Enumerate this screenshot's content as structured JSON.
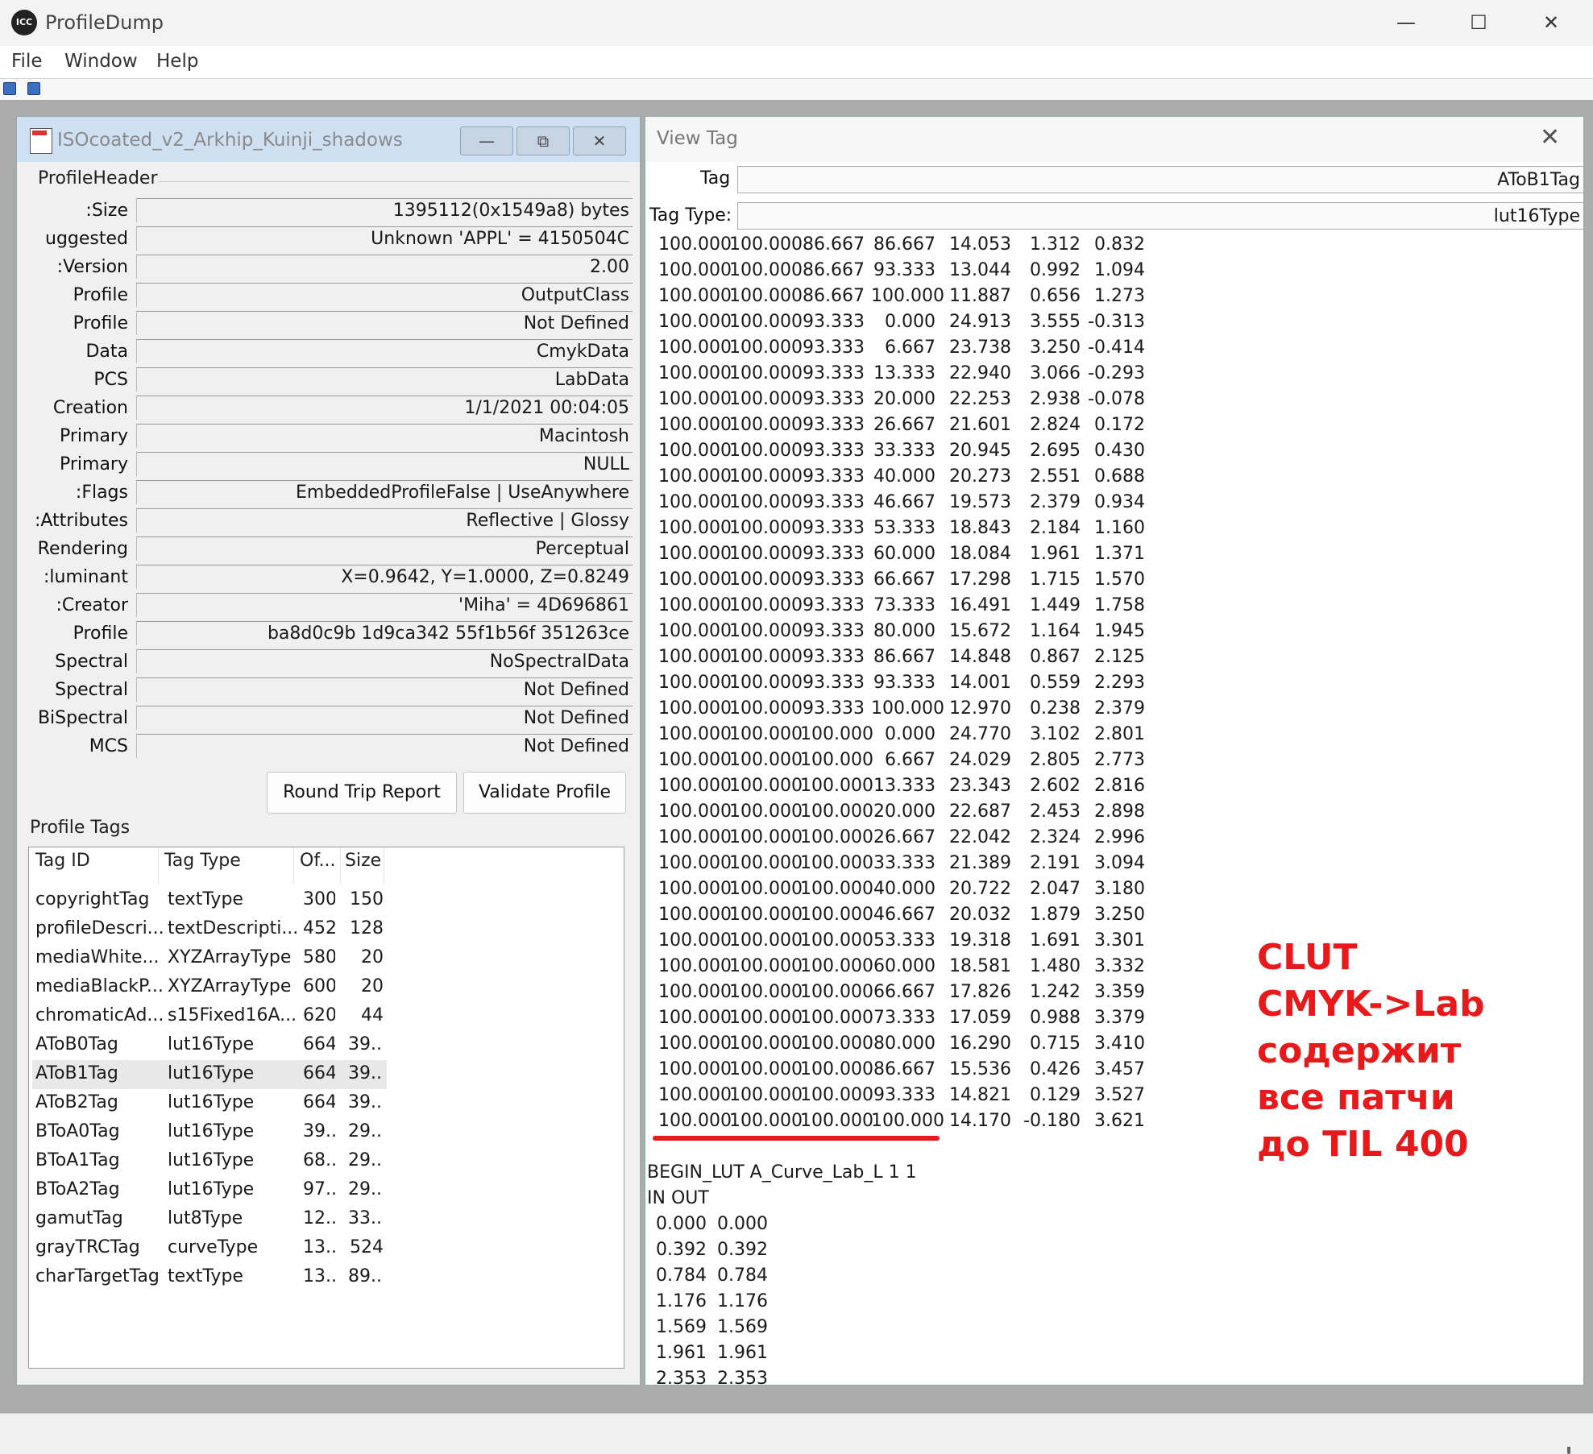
{
  "app": {
    "title": "ProfileDump",
    "icon_name": "icc-logo-icon"
  },
  "menu": [
    "File",
    "Window",
    "Help"
  ],
  "profile_window": {
    "title": "ISOcoated_v2_Arkhip_Kuinji_shadows",
    "section_header": "ProfileHeader",
    "header_fields": [
      {
        "label": "Size:",
        "value": "1395112(0x1549a8) bytes"
      },
      {
        "label": "uggested",
        "value": "Unknown 'APPL' = 4150504C"
      },
      {
        "label": "Version:",
        "value": "2.00"
      },
      {
        "label": "Profile",
        "value": "OutputClass"
      },
      {
        "label": "Profile",
        "value": "Not Defined"
      },
      {
        "label": "Data",
        "value": "CmykData"
      },
      {
        "label": "PCS",
        "value": "LabData"
      },
      {
        "label": "Creation",
        "value": "1/1/2021  00:04:05"
      },
      {
        "label": "Primary",
        "value": "Macintosh"
      },
      {
        "label": "Primary",
        "value": "NULL"
      },
      {
        "label": "Flags:",
        "value": "EmbeddedProfileFalse | UseAnywhere"
      },
      {
        "label": "Attributes:",
        "value": "Reflective | Glossy"
      },
      {
        "label": "Rendering",
        "value": "Perceptual"
      },
      {
        "label": "luminant:",
        "value": "X=0.9642, Y=1.0000, Z=0.8249"
      },
      {
        "label": "Creator:",
        "value": "'Miha' = 4D696861"
      },
      {
        "label": "Profile",
        "value": "ba8d0c9b 1d9ca342 55f1b56f 351263ce"
      },
      {
        "label": "Spectral",
        "value": "NoSpectralData"
      },
      {
        "label": "Spectral",
        "value": "Not Defined"
      },
      {
        "label": "BiSpectral",
        "value": "Not Defined"
      },
      {
        "label": "MCS",
        "value": "Not Defined"
      }
    ],
    "buttons": {
      "round_trip": "Round Trip Report",
      "validate": "Validate Profile"
    },
    "tags_label": "Profile Tags",
    "tags_columns": [
      "Tag ID",
      "Tag Type",
      "Of...",
      "Size"
    ],
    "tags": [
      [
        "copyrightTag",
        "textType",
        "300",
        "150"
      ],
      [
        "profileDescri...",
        "textDescripti...",
        "452",
        "128"
      ],
      [
        "mediaWhite...",
        "XYZArrayType",
        "580",
        "20"
      ],
      [
        "mediaBlackP...",
        "XYZArrayType",
        "600",
        "20"
      ],
      [
        "chromaticAd...",
        "s15Fixed16A...",
        "620",
        "44"
      ],
      [
        "AToB0Tag",
        "lut16Type",
        "664",
        "39..."
      ],
      [
        "AToB1Tag",
        "lut16Type",
        "664",
        "39..."
      ],
      [
        "AToB2Tag",
        "lut16Type",
        "664",
        "39..."
      ],
      [
        "BToA0Tag",
        "lut16Type",
        "39...",
        "29..."
      ],
      [
        "BToA1Tag",
        "lut16Type",
        "68...",
        "29..."
      ],
      [
        "BToA2Tag",
        "lut16Type",
        "97...",
        "29..."
      ],
      [
        "gamutTag",
        "lut8Type",
        "12...",
        "33..."
      ],
      [
        "grayTRCTag",
        "curveType",
        "13...",
        "524"
      ],
      [
        "charTargetTag",
        "textType",
        "13...",
        "89..."
      ]
    ],
    "selected_tag": "AToB1Tag"
  },
  "view_tag": {
    "title": "View Tag",
    "tag_label": "Tag",
    "tag_value": "AToB1Tag",
    "type_label": "Tag Type:",
    "type_value": "lut16Type",
    "clut_rows": [
      [
        "100.000",
        "100.000",
        "86.667",
        "86.667",
        "14.053",
        "1.312",
        "0.832"
      ],
      [
        "100.000",
        "100.000",
        "86.667",
        "93.333",
        "13.044",
        "0.992",
        "1.094"
      ],
      [
        "100.000",
        "100.000",
        "86.667",
        "100.000",
        "11.887",
        "0.656",
        "1.273"
      ],
      [
        "100.000",
        "100.000",
        "93.333",
        "0.000",
        "24.913",
        "3.555",
        "-0.313"
      ],
      [
        "100.000",
        "100.000",
        "93.333",
        "6.667",
        "23.738",
        "3.250",
        "-0.414"
      ],
      [
        "100.000",
        "100.000",
        "93.333",
        "13.333",
        "22.940",
        "3.066",
        "-0.293"
      ],
      [
        "100.000",
        "100.000",
        "93.333",
        "20.000",
        "22.253",
        "2.938",
        "-0.078"
      ],
      [
        "100.000",
        "100.000",
        "93.333",
        "26.667",
        "21.601",
        "2.824",
        "0.172"
      ],
      [
        "100.000",
        "100.000",
        "93.333",
        "33.333",
        "20.945",
        "2.695",
        "0.430"
      ],
      [
        "100.000",
        "100.000",
        "93.333",
        "40.000",
        "20.273",
        "2.551",
        "0.688"
      ],
      [
        "100.000",
        "100.000",
        "93.333",
        "46.667",
        "19.573",
        "2.379",
        "0.934"
      ],
      [
        "100.000",
        "100.000",
        "93.333",
        "53.333",
        "18.843",
        "2.184",
        "1.160"
      ],
      [
        "100.000",
        "100.000",
        "93.333",
        "60.000",
        "18.084",
        "1.961",
        "1.371"
      ],
      [
        "100.000",
        "100.000",
        "93.333",
        "66.667",
        "17.298",
        "1.715",
        "1.570"
      ],
      [
        "100.000",
        "100.000",
        "93.333",
        "73.333",
        "16.491",
        "1.449",
        "1.758"
      ],
      [
        "100.000",
        "100.000",
        "93.333",
        "80.000",
        "15.672",
        "1.164",
        "1.945"
      ],
      [
        "100.000",
        "100.000",
        "93.333",
        "86.667",
        "14.848",
        "0.867",
        "2.125"
      ],
      [
        "100.000",
        "100.000",
        "93.333",
        "93.333",
        "14.001",
        "0.559",
        "2.293"
      ],
      [
        "100.000",
        "100.000",
        "93.333",
        "100.000",
        "12.970",
        "0.238",
        "2.379"
      ],
      [
        "100.000",
        "100.000",
        "100.000",
        "0.000",
        "24.770",
        "3.102",
        "2.801"
      ],
      [
        "100.000",
        "100.000",
        "100.000",
        "6.667",
        "24.029",
        "2.805",
        "2.773"
      ],
      [
        "100.000",
        "100.000",
        "100.000",
        "13.333",
        "23.343",
        "2.602",
        "2.816"
      ],
      [
        "100.000",
        "100.000",
        "100.000",
        "20.000",
        "22.687",
        "2.453",
        "2.898"
      ],
      [
        "100.000",
        "100.000",
        "100.000",
        "26.667",
        "22.042",
        "2.324",
        "2.996"
      ],
      [
        "100.000",
        "100.000",
        "100.000",
        "33.333",
        "21.389",
        "2.191",
        "3.094"
      ],
      [
        "100.000",
        "100.000",
        "100.000",
        "40.000",
        "20.722",
        "2.047",
        "3.180"
      ],
      [
        "100.000",
        "100.000",
        "100.000",
        "46.667",
        "20.032",
        "1.879",
        "3.250"
      ],
      [
        "100.000",
        "100.000",
        "100.000",
        "53.333",
        "19.318",
        "1.691",
        "3.301"
      ],
      [
        "100.000",
        "100.000",
        "100.000",
        "60.000",
        "18.581",
        "1.480",
        "3.332"
      ],
      [
        "100.000",
        "100.000",
        "100.000",
        "66.667",
        "17.826",
        "1.242",
        "3.359"
      ],
      [
        "100.000",
        "100.000",
        "100.000",
        "73.333",
        "17.059",
        "0.988",
        "3.379"
      ],
      [
        "100.000",
        "100.000",
        "100.000",
        "80.000",
        "16.290",
        "0.715",
        "3.410"
      ],
      [
        "100.000",
        "100.000",
        "100.000",
        "86.667",
        "15.536",
        "0.426",
        "3.457"
      ],
      [
        "100.000",
        "100.000",
        "100.000",
        "93.333",
        "14.821",
        "0.129",
        "3.527"
      ],
      [
        "100.000",
        "100.000",
        "100.000",
        "100.000",
        "14.170",
        "-0.180",
        "3.621"
      ]
    ],
    "curve_header": "BEGIN_LUT A_Curve_Lab_L 1 1",
    "curve_columns": "IN OUT",
    "curve_rows": [
      [
        "0.000",
        "0.000"
      ],
      [
        "0.392",
        "0.392"
      ],
      [
        "0.784",
        "0.784"
      ],
      [
        "1.176",
        "1.176"
      ],
      [
        "1.569",
        "1.569"
      ],
      [
        "1.961",
        "1.961"
      ],
      [
        "2.353",
        "2.353"
      ]
    ]
  },
  "annotation": {
    "lines": [
      "CLUT",
      "CMYK->Lab",
      "содержит",
      "все патчи",
      "до TIL 400"
    ],
    "color": "#e8191b"
  }
}
